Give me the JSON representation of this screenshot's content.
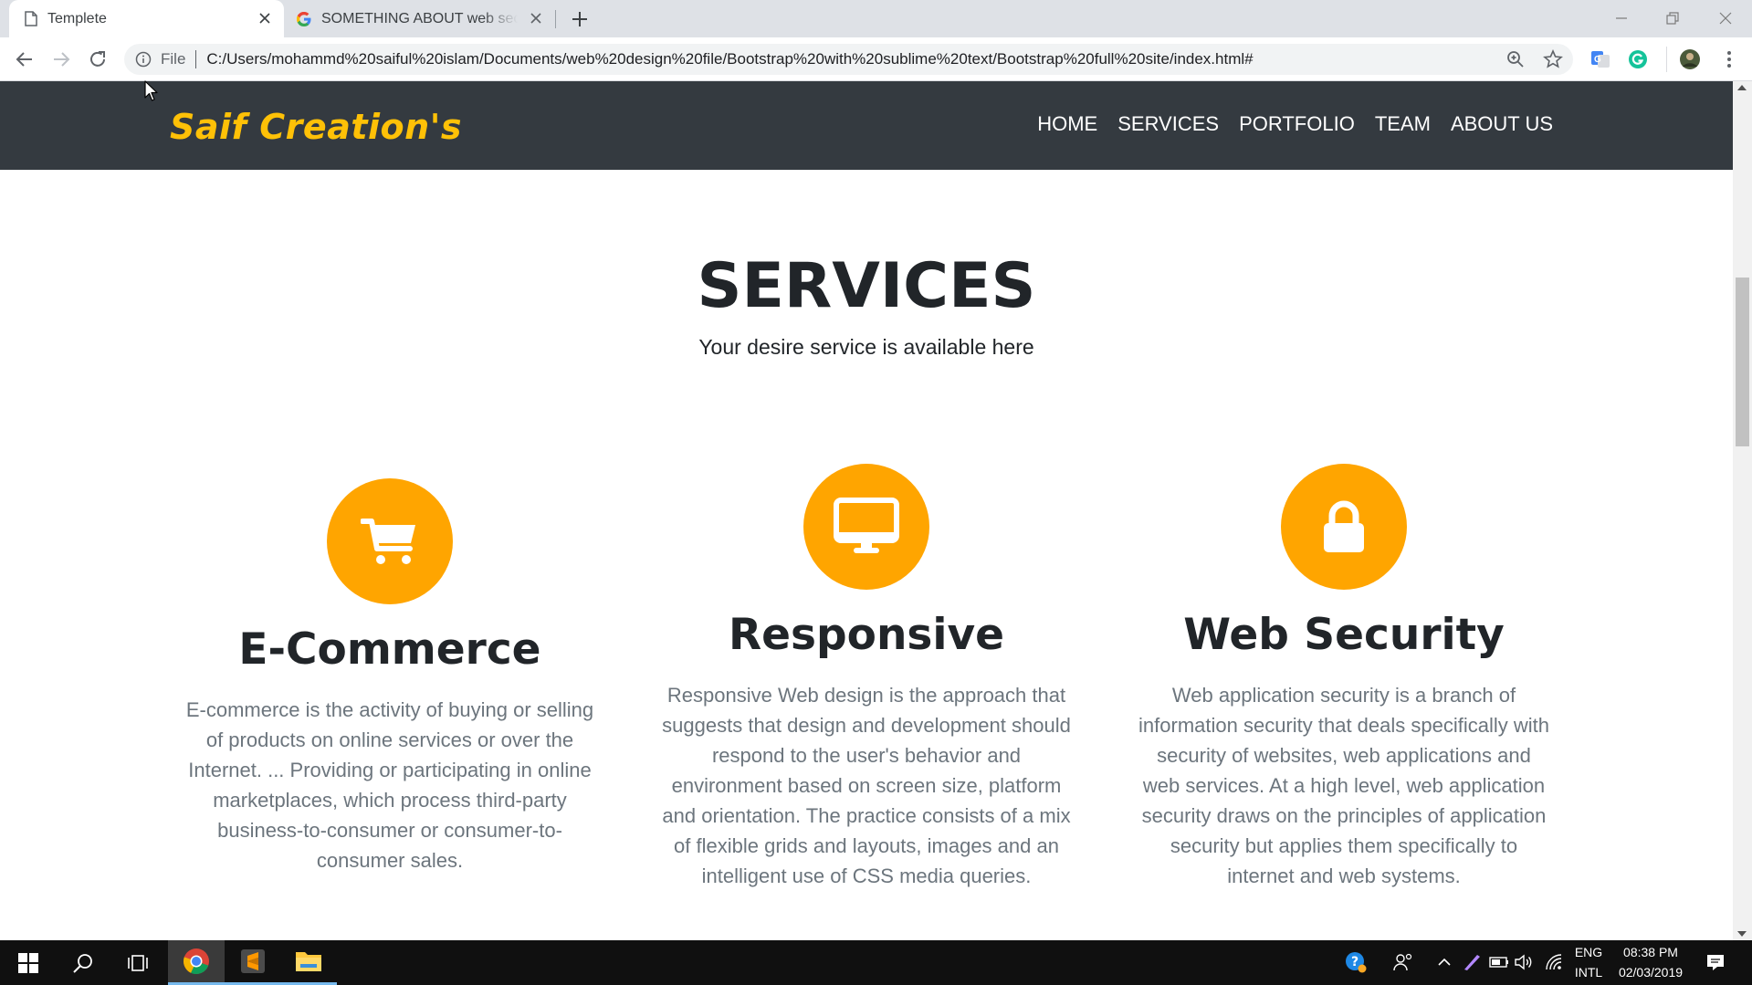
{
  "browser": {
    "tabs": [
      {
        "title": "Templete",
        "icon": "page-icon"
      },
      {
        "title": "SOMETHING ABOUT web security",
        "icon": "google-icon"
      }
    ],
    "omnibox": {
      "scheme_label": "File",
      "url": "C:/Users/mohammd%20saiful%20islam/Documents/web%20design%20file/Bootstrap%20with%20sublime%20text/Bootstrap%20full%20site/index.html#"
    }
  },
  "site": {
    "brand": "Saif Creation's",
    "nav": [
      "HOME",
      "SERVICES",
      "PORTFOLIO",
      "TEAM",
      "ABOUT US"
    ],
    "section": {
      "title": "SERVICES",
      "subtitle": "Your desire service is available here"
    },
    "services": [
      {
        "icon": "shopping-cart-icon",
        "title": "E-Commerce",
        "text": "E-commerce is the activity of buying or selling of products on online services or over the Internet. ... Providing or participating in online marketplaces, which process third-party business-to-consumer or consumer-to-consumer sales."
      },
      {
        "icon": "desktop-monitor-icon",
        "title": "Responsive",
        "text": "Responsive Web design is the approach that suggests that design and development should respond to the user's behavior and environment based on screen size, platform and orientation. The practice consists of a mix of flexible grids and layouts, images and an intelligent use of CSS media queries."
      },
      {
        "icon": "lock-icon",
        "title": "Web Security",
        "text": "Web application security is a branch of information security that deals specifically with security of websites, web applications and web services. At a high level, web application security draws on the principles of application security but applies them specifically to internet and web systems."
      }
    ],
    "colors": {
      "navbar": "#343a40",
      "brand": "#ffc107",
      "accent_circle": "#ffa500",
      "heading": "#212529",
      "body_text": "#6c757d"
    }
  },
  "taskbar": {
    "language": "ENG",
    "layout": "INTL",
    "time": "08:38 PM",
    "date": "02/03/2019",
    "apps": [
      "start-windows-icon",
      "search-icon",
      "task-view-icon",
      "chrome-icon",
      "sublime-text-icon",
      "file-explorer-icon"
    ]
  }
}
